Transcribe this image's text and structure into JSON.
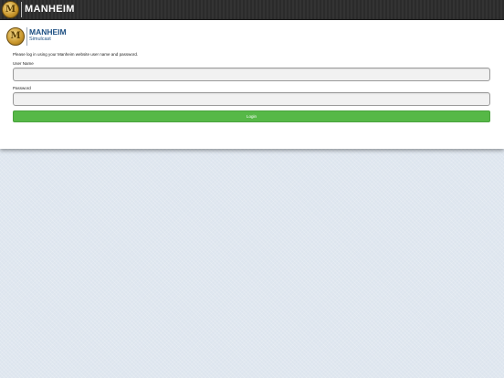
{
  "header": {
    "brand": "MANHEIM",
    "logo_icon": "manheim-m-logo-icon",
    "logo_glyph": "M"
  },
  "login": {
    "brand": "MANHEIM",
    "brand_sub": "Simulcast",
    "logo_glyph": "M",
    "instructions": "Please log in using your Manheim website user name and password.",
    "username_label": "User Name",
    "username_value": "",
    "password_label": "Password",
    "password_value": "",
    "login_button": "Login"
  },
  "colors": {
    "header_bg": "#2f2f2f",
    "brand_blue": "#1d4f82",
    "button_green": "#56b847",
    "background": "#dde5ee"
  }
}
